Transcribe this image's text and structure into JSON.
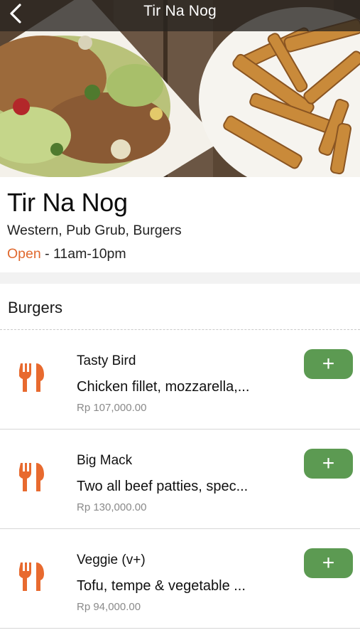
{
  "header": {
    "title": "Tir Na Nog",
    "back_icon": "chevron-left-icon"
  },
  "restaurant": {
    "name": "Tir Na Nog",
    "cuisine": "Western, Pub Grub, Burgers",
    "status": "Open",
    "hours": " - 11am-10pm"
  },
  "menu": {
    "section_title": "Burgers",
    "items": [
      {
        "name": "Tasty Bird",
        "description": "Chicken fillet, mozzarella,...",
        "price": "Rp 107,000.00",
        "add_label": "+",
        "icon": "fork-knife-icon"
      },
      {
        "name": "Big Mack",
        "description": "Two all beef patties, spec...",
        "price": "Rp 130,000.00",
        "add_label": "+",
        "icon": "fork-knife-icon"
      },
      {
        "name": "Veggie (v+)",
        "description": "Tofu, tempe & vegetable ...",
        "price": "Rp 94,000.00",
        "add_label": "+",
        "icon": "fork-knife-icon"
      }
    ]
  },
  "colors": {
    "accent_orange": "#e0692f",
    "add_button_green": "#5c9a52",
    "icon_orange": "#e86a2f"
  }
}
